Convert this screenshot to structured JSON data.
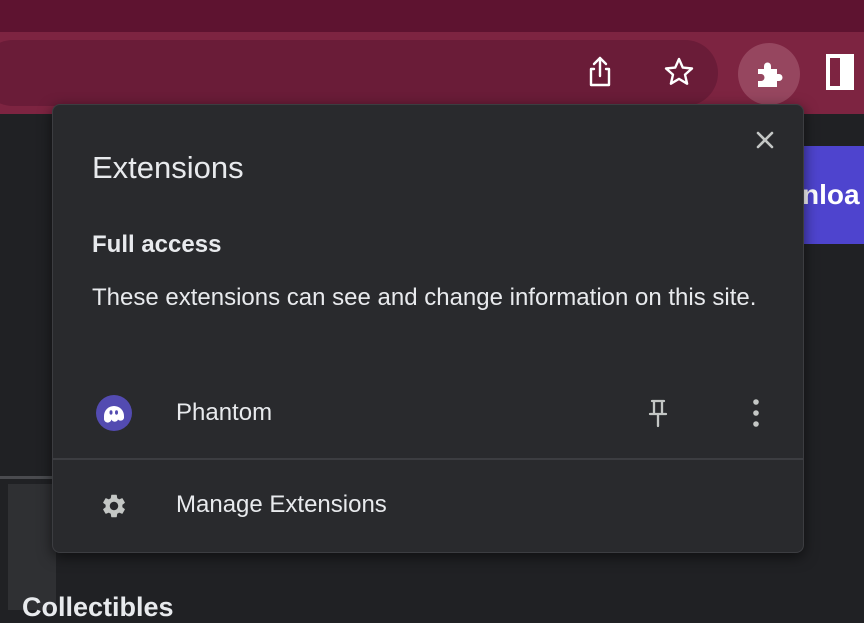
{
  "popup": {
    "title": "Extensions",
    "section_title": "Full access",
    "section_description": "These extensions can see and change information on this site.",
    "extensions": [
      {
        "name": "Phantom",
        "icon": "phantom-ghost-icon"
      }
    ],
    "manage_label": "Manage Extensions"
  },
  "background": {
    "button_text": "nloa",
    "heading_text": "Collectibles"
  },
  "colors": {
    "tab_strip": "#5e1330",
    "toolbar": "#7d2441",
    "popup_bg": "#292a2d",
    "phantom_purple": "#534bb1",
    "download_button": "#4e44ce"
  }
}
